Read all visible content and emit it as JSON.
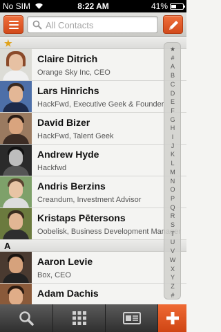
{
  "status_bar": {
    "carrier": "No SIM",
    "time": "8:22 AM",
    "battery": "41%",
    "battery_level": 0.41
  },
  "search": {
    "placeholder": "All Contacts",
    "value": ""
  },
  "sections": [
    {
      "header": "★",
      "contacts": [
        {
          "name": "Claire Ditrich",
          "subtitle": "Orange Sky Inc, CEO"
        },
        {
          "name": "Lars Hinrichs",
          "subtitle": "HackFwd, Executive Geek & Founder"
        },
        {
          "name": "David Bizer",
          "subtitle": "HackFwd, Talent Geek"
        },
        {
          "name": "Andrew Hyde",
          "subtitle": "Hackfwd"
        },
        {
          "name": "Andris Berzins",
          "subtitle": "Creandum, Investment Advisor"
        },
        {
          "name": "Kristaps Pētersons",
          "subtitle": "Oobelisk, Business Development Manager"
        }
      ]
    },
    {
      "header": "A",
      "contacts": [
        {
          "name": "Aaron Levie",
          "subtitle": "Box, CEO"
        },
        {
          "name": "Adam Dachis",
          "subtitle": ""
        }
      ]
    }
  ],
  "alpha_index": [
    "★",
    "#",
    "A",
    "B",
    "C",
    "D",
    "E",
    "F",
    "G",
    "H",
    "I",
    "J",
    "K",
    "L",
    "M",
    "N",
    "O",
    "P",
    "Q",
    "R",
    "S",
    "T",
    "U",
    "V",
    "W",
    "X",
    "Y",
    "Z",
    "#"
  ],
  "tabs": [
    {
      "name": "search-tab-icon"
    },
    {
      "name": "grid-tab-icon"
    },
    {
      "name": "card-tab-icon"
    },
    {
      "name": "add-contact-icon"
    }
  ],
  "colors": {
    "accent": "#e05a26",
    "star": "#e0a21a",
    "tabbar": "#3a3a3a"
  }
}
